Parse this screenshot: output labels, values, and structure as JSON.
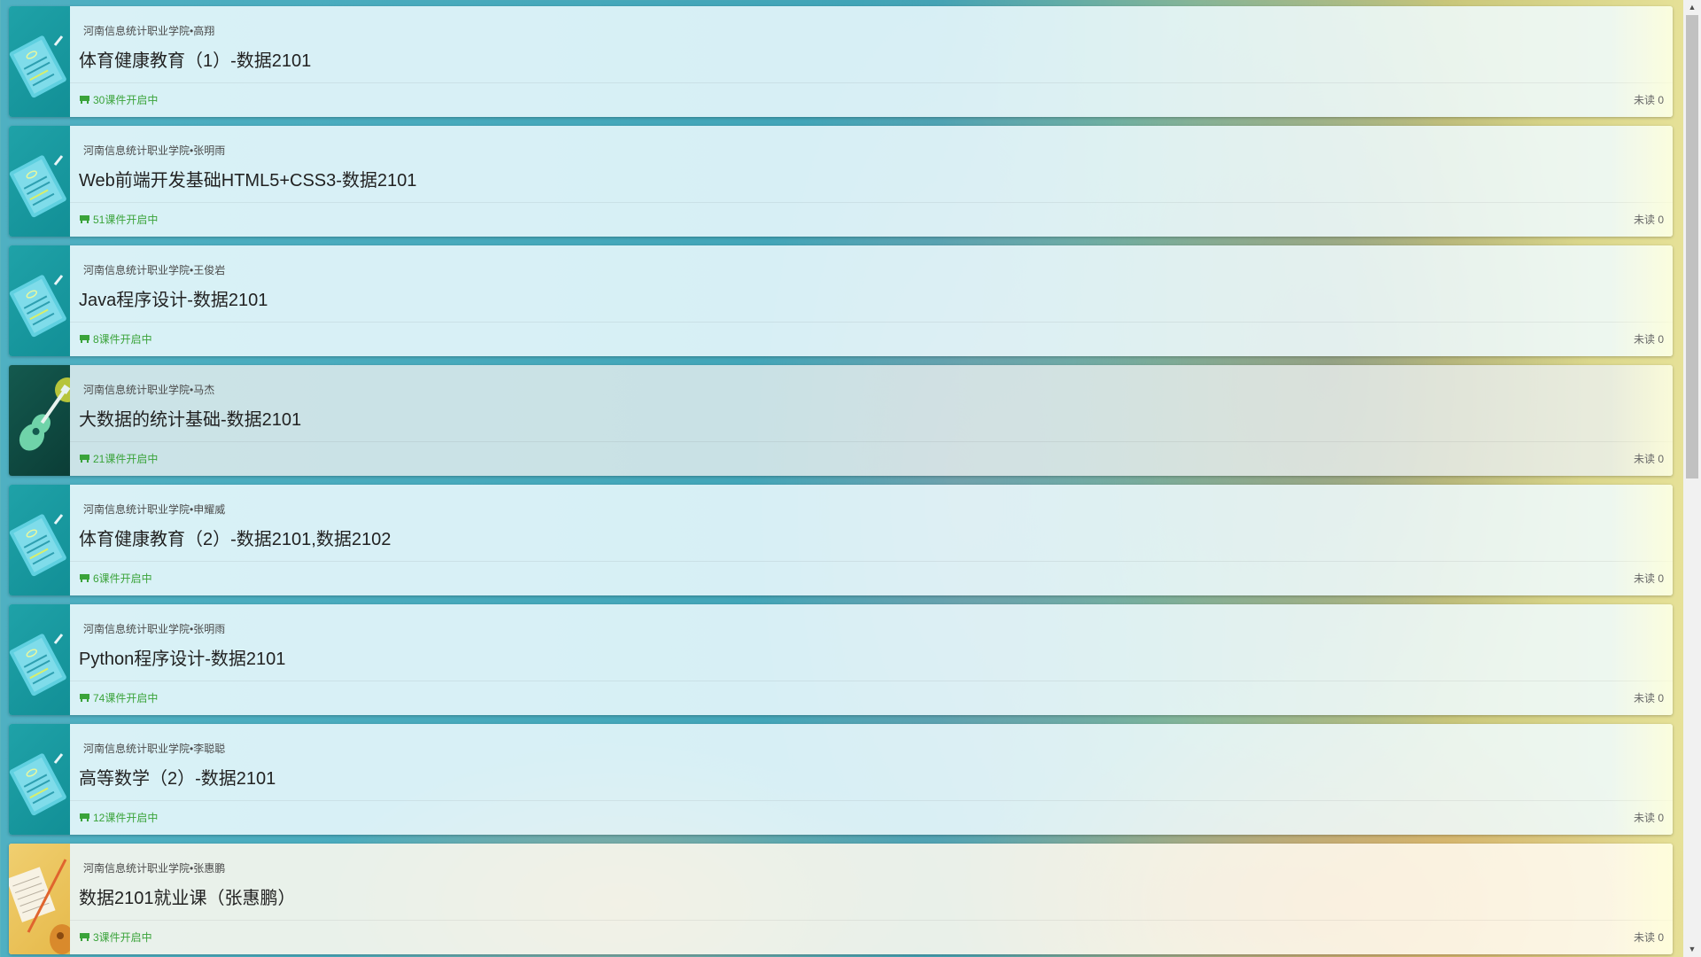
{
  "courses": [
    {
      "school": "河南信息统计职业学院•高翔",
      "title": "体育健康教育（1）-数据2101",
      "status": "30课件开启中",
      "unread": "未读 0",
      "cover": "teal"
    },
    {
      "school": "河南信息统计职业学院•张明雨",
      "title": "Web前端开发基础HTML5+CSS3-数据2101",
      "status": "51课件开启中",
      "unread": "未读 0",
      "cover": "teal"
    },
    {
      "school": "河南信息统计职业学院•王俊岩",
      "title": "Java程序设计-数据2101",
      "status": "8课件开启中",
      "unread": "未读 0",
      "cover": "teal"
    },
    {
      "school": "河南信息统计职业学院•马杰",
      "title": "大数据的统计基础-数据2101",
      "status": "21课件开启中",
      "unread": "未读 0",
      "cover": "dark"
    },
    {
      "school": "河南信息统计职业学院•申耀威",
      "title": "体育健康教育（2）-数据2101,数据2102",
      "status": "6课件开启中",
      "unread": "未读 0",
      "cover": "teal"
    },
    {
      "school": "河南信息统计职业学院•张明雨",
      "title": "Python程序设计-数据2101",
      "status": "74课件开启中",
      "unread": "未读 0",
      "cover": "teal"
    },
    {
      "school": "河南信息统计职业学院•李聪聪",
      "title": "高等数学（2）-数据2101",
      "status": "12课件开启中",
      "unread": "未读 0",
      "cover": "teal"
    },
    {
      "school": "河南信息统计职业学院•张惠鹏",
      "title": "数据2101就业课（张惠鹏）",
      "status": "3课件开启中",
      "unread": "未读 0",
      "cover": "yellow"
    }
  ],
  "icons": {
    "status": "courseware-icon",
    "scroll_up": "▲",
    "scroll_down": "▼"
  },
  "colors": {
    "status_green": "#3aa33a",
    "cover_teal": "#1fa2a8",
    "cover_dark": "#0b3d36",
    "cover_yellow": "#e6b94a"
  }
}
